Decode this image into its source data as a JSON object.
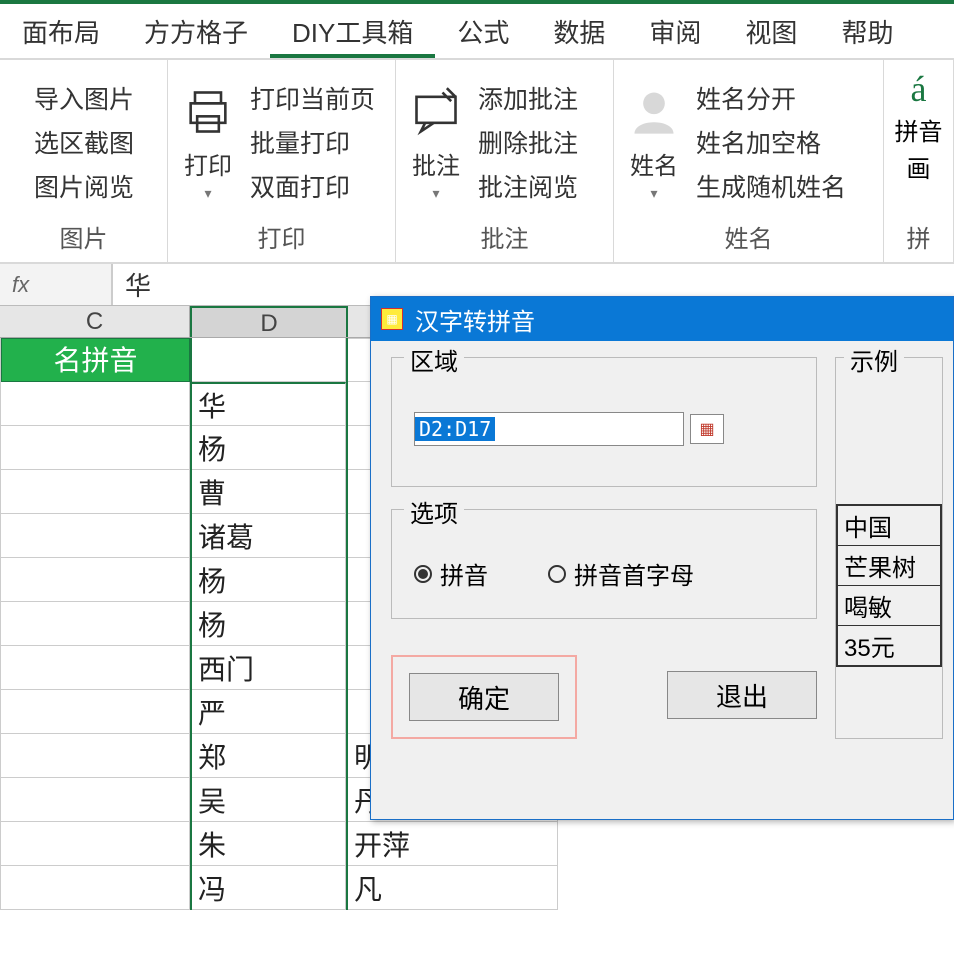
{
  "tabs": [
    "面布局",
    "方方格子",
    "DIY工具箱",
    "公式",
    "数据",
    "审阅",
    "视图",
    "帮助"
  ],
  "active_tab": "DIY工具箱",
  "ribbon": {
    "pic": {
      "label": "图片",
      "items": [
        "导入图片",
        "选区截图",
        "图片阅览"
      ]
    },
    "print": {
      "label": "打印",
      "big": "打印",
      "items": [
        "打印当前页",
        "批量打印",
        "双面打印"
      ]
    },
    "comment": {
      "label": "批注",
      "big": "批注",
      "items": [
        "添加批注",
        "删除批注",
        "批注阅览"
      ]
    },
    "name": {
      "label": "姓名",
      "big": "姓名",
      "items": [
        "姓名分开",
        "姓名加空格",
        "生成随机姓名"
      ]
    },
    "pinyin": {
      "label": "拼",
      "big": "拼音",
      "sub": "画",
      "mark": "á"
    }
  },
  "formula_bar": {
    "fx": "fx",
    "value": "华"
  },
  "columns": {
    "c": "C",
    "d": "D",
    "header_c": "名拼音"
  },
  "cells_d": [
    "华",
    "杨",
    "曹",
    "诸葛",
    "杨",
    "杨",
    "西门",
    "严",
    "郑",
    "吴",
    "朱",
    "冯"
  ],
  "cells_e": [
    "",
    "",
    "",
    "",
    "",
    "",
    "",
    "",
    "明",
    "丹",
    "开萍",
    "凡"
  ],
  "dialog": {
    "title": "汉字转拼音",
    "region_label": "区域",
    "range": "D2:D17",
    "option_label": "选项",
    "radio1": "拼音",
    "radio2": "拼音首字母",
    "ok": "确定",
    "exit": "退出",
    "example_label": "示例",
    "examples": [
      "中国",
      "芒果树",
      "喝敏",
      "35元"
    ]
  }
}
